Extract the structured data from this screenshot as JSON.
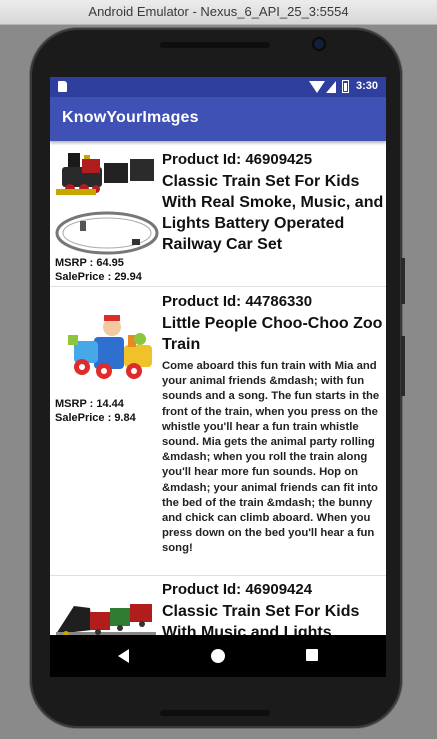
{
  "window": {
    "title": "Android Emulator - Nexus_6_API_25_3:5554"
  },
  "status_bar": {
    "time": "3:30"
  },
  "app_bar": {
    "title": "KnowYourImages"
  },
  "products": [
    {
      "id_label": "Product Id: 46909425",
      "name": "Classic Train Set For Kids With Real Smoke, Music, and Lights Battery Operated Railway Car Set",
      "description": "",
      "msrp": "MSRP : 64.95",
      "sale_price": "SalePrice : 29.94",
      "image": "train-set-image"
    },
    {
      "id_label": "Product Id: 44786330",
      "name": "Little People Choo-Choo Zoo Train",
      "description": "Come aboard this fun train with Mia and your animal friends &mdash; with fun sounds and a song. The fun starts in the front of the train, when you press on the whistle you'll hear a fun train whistle sound. Mia gets the animal party rolling &mdash; when you roll the train along you'll hear more fun sounds. Hop on &mdash; your animal friends can fit into the bed of the train &mdash; the bunny and chick can climb aboard. When you press down on the bed you'll hear a fun song!",
      "msrp": "MSRP : 14.44",
      "sale_price": "SalePrice : 9.84",
      "image": "toy-zoo-train-image"
    },
    {
      "id_label": "Product Id: 46909424",
      "name": "Classic Train Set For Kids With Music and Lights",
      "description": "",
      "msrp": "",
      "sale_price": "",
      "image": "train-set-image"
    }
  ],
  "colors": {
    "primary": "#3f51b5",
    "primary_dark": "#2f3f9e"
  }
}
